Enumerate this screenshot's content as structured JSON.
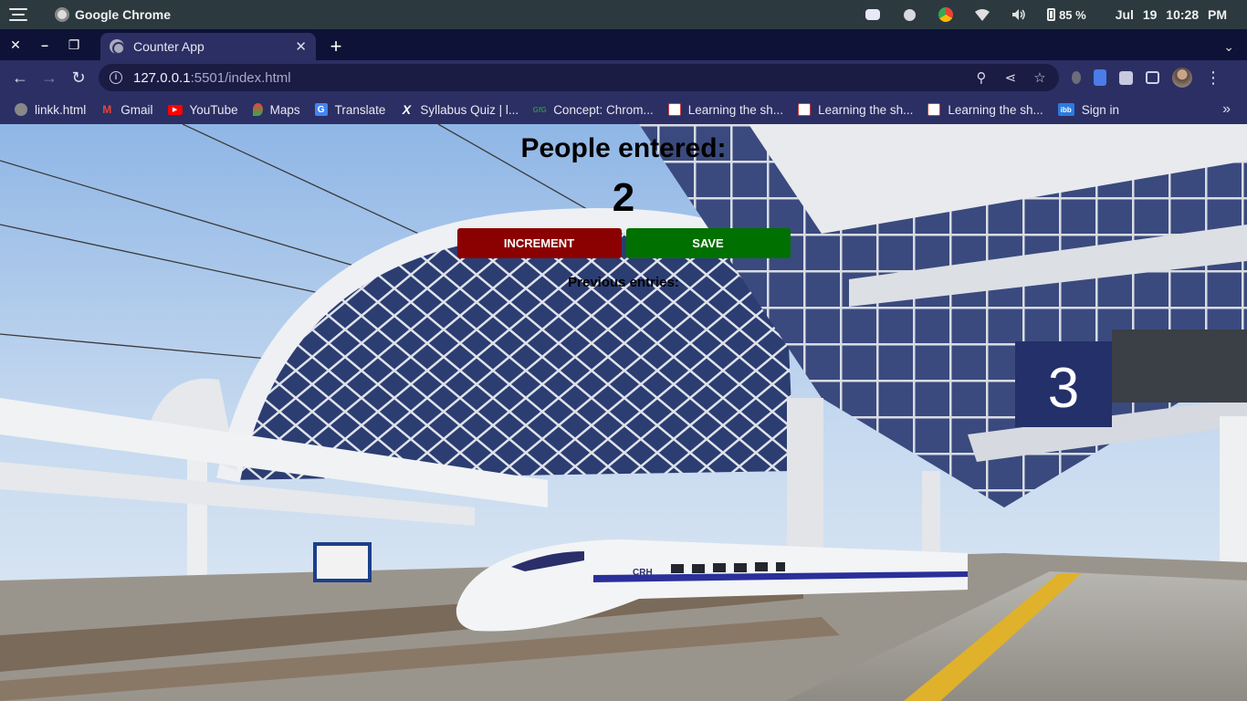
{
  "os": {
    "app_name": "Google Chrome",
    "battery": "85 %",
    "date": "Jul 19",
    "time": "10:28 PM"
  },
  "tab": {
    "title": "Counter App"
  },
  "address": {
    "host": "127.0.0.1",
    "rest": ":5501/index.html"
  },
  "bookmarks": [
    {
      "label": "linkk.html",
      "icon": "globe-icon",
      "color": "#888888"
    },
    {
      "label": "Gmail",
      "icon": "gmail-icon",
      "color": "#ea4335"
    },
    {
      "label": "YouTube",
      "icon": "youtube-icon",
      "color": "#ff0000"
    },
    {
      "label": "Maps",
      "icon": "maps-icon",
      "color": "#34a853"
    },
    {
      "label": "Translate",
      "icon": "translate-icon",
      "color": "#4285f4"
    },
    {
      "label": "Syllabus Quiz | l...",
      "icon": "x-icon",
      "color": "#000000"
    },
    {
      "label": "Concept: Chrom...",
      "icon": "gfg-icon",
      "color": "#2f8d46"
    },
    {
      "label": "Learning the sh...",
      "icon": "doc-icon",
      "color": "#ffffff"
    },
    {
      "label": "Learning the sh...",
      "icon": "doc-icon",
      "color": "#ffffff"
    },
    {
      "label": "Learning the sh...",
      "icon": "doc-icon",
      "color": "#ffffff"
    },
    {
      "label": "Sign in",
      "icon": "ibb-icon",
      "color": "#2b7be0"
    }
  ],
  "page": {
    "heading": "People entered:",
    "count": "2",
    "increment_label": "INCREMENT",
    "save_label": "SAVE",
    "previous_label": "Previous entries:"
  },
  "colors": {
    "increment": "#8b0000",
    "save": "#007000"
  }
}
